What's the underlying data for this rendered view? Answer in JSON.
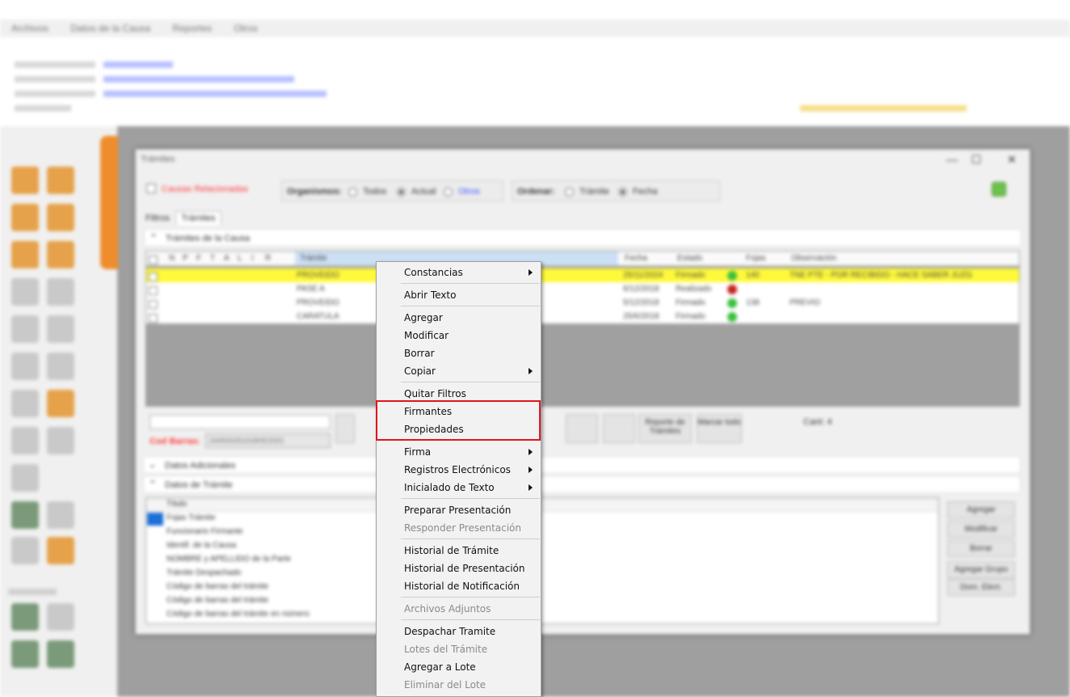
{
  "app": {
    "menubar": [
      "Archivos",
      "Datos de la Causa",
      "Reportes",
      "Otros"
    ]
  },
  "dialog": {
    "title": "Trámites",
    "causas_relacionadas": "Causas Relacionadas",
    "organismos": {
      "label": "Organismos:",
      "options": [
        "Todos",
        "Actual",
        "Otros"
      ],
      "selected": "Actual"
    },
    "ordenar": {
      "label": "Ordenar:",
      "options": [
        "Trámite",
        "Fecha"
      ],
      "selected": "Fecha"
    },
    "tabs": [
      "Filtros",
      "Trámites"
    ],
    "active_tab": "Trámites",
    "section_tramites": "Trámites de la Causa",
    "grid": {
      "columns": [
        "N",
        "P",
        "F",
        "T",
        "A",
        "L",
        "I",
        "R",
        "Trámite",
        "Fecha",
        "Estado",
        "Fojas",
        "Observación"
      ],
      "rows": [
        {
          "tramite": "PROVEIDO",
          "fecha": "25/11/2024",
          "estado": "Firmado",
          "fojas": "140",
          "obs": "TNE PTE - POR RECIBIDO - HACE SABER JUZG",
          "status": "ok",
          "selected": true
        },
        {
          "tramite": "PASE A",
          "fecha": "6/12/2018",
          "estado": "Realizado",
          "fojas": "",
          "obs": "",
          "status": "red",
          "selected": false
        },
        {
          "tramite": "PROVEIDO",
          "fecha": "5/12/2018",
          "estado": "Firmado",
          "fojas": "138",
          "obs": "PREVIO",
          "status": "ok",
          "selected": false
        },
        {
          "tramite": "CARATULA",
          "fecha": "25/6/2018",
          "estado": "Firmado",
          "fojas": "",
          "obs": "",
          "status": "ok",
          "selected": false
        }
      ]
    },
    "cod_barras_label": "Cod Barras:",
    "cod_barras_value": "24450025101805/2001",
    "reporte_btn": "Reporte de Trámites",
    "marcar_btn": "Marcar todo",
    "cant": "Cant: 4",
    "section_adicionales": "Datos Adicionales",
    "section_datos": "Datos de Trámite",
    "list_header": "Título",
    "list_items": [
      "Fojas Trámite",
      "Funcionario Firmante",
      "Identif. de la Causa",
      "NOMBRE y APELLIDO de la Parte",
      "Trámite Despachado",
      "Código de barras del trámite",
      "Código de barras del trámite",
      "Código de barras del trámite en número"
    ],
    "right_buttons": [
      "Agregar",
      "Modificar",
      "Borrar",
      "Agregar Grupo",
      "Dom. Elect."
    ]
  },
  "context_menu": {
    "groups": [
      [
        {
          "label": "Constancias",
          "submenu": true,
          "disabled": false
        }
      ],
      [
        {
          "label": "Abrir Texto",
          "submenu": false,
          "disabled": false
        }
      ],
      [
        {
          "label": "Agregar",
          "submenu": false,
          "disabled": false
        },
        {
          "label": "Modificar",
          "submenu": false,
          "disabled": false
        },
        {
          "label": "Borrar",
          "submenu": false,
          "disabled": false
        },
        {
          "label": "Copiar",
          "submenu": true,
          "disabled": false
        }
      ],
      [
        {
          "label": "Quitar Filtros",
          "submenu": false,
          "disabled": false
        },
        {
          "label": "Firmantes",
          "submenu": false,
          "disabled": false
        },
        {
          "label": "Propiedades",
          "submenu": false,
          "disabled": false
        }
      ],
      [
        {
          "label": "Firma",
          "submenu": true,
          "disabled": false
        },
        {
          "label": "Registros Electrónicos",
          "submenu": true,
          "disabled": false
        },
        {
          "label": "Inicialado de Texto",
          "submenu": true,
          "disabled": false
        }
      ],
      [
        {
          "label": "Preparar Presentación",
          "submenu": false,
          "disabled": false
        },
        {
          "label": "Responder Presentación",
          "submenu": false,
          "disabled": true
        }
      ],
      [
        {
          "label": "Historial de Trámite",
          "submenu": false,
          "disabled": false
        },
        {
          "label": "Historial de Presentación",
          "submenu": false,
          "disabled": false
        },
        {
          "label": "Historial de Notificación",
          "submenu": false,
          "disabled": false
        }
      ],
      [
        {
          "label": "Archivos Adjuntos",
          "submenu": false,
          "disabled": true
        }
      ],
      [
        {
          "label": "Despachar Tramite",
          "submenu": false,
          "disabled": false
        },
        {
          "label": "Lotes del Trámite",
          "submenu": false,
          "disabled": true
        },
        {
          "label": "Agregar a Lote",
          "submenu": false,
          "disabled": false
        },
        {
          "label": "Eliminar del Lote",
          "submenu": false,
          "disabled": true
        }
      ]
    ]
  },
  "highlight_color": "#e0141e"
}
